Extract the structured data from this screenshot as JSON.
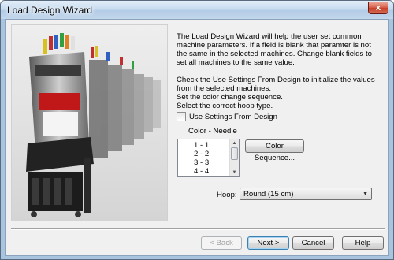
{
  "window": {
    "title": "Load Design Wizard",
    "close_label": "x"
  },
  "image": {
    "icon": "embroidery-machines-photo"
  },
  "intro": {
    "paragraph1": "The Load Design Wizard will help the user set common machine parameters. If a field is blank that paramter is not the same in the selected machines. Change blank fields to set all machines to the same value.",
    "line1": "Check the Use Settings From Design to initialize the values from the selected machines.",
    "line2": "Set the color change sequence.",
    "line3": "Select the correct hoop type."
  },
  "use_settings": {
    "label": "Use Settings From Design",
    "checked": false
  },
  "color_needle": {
    "label": "Color - Needle",
    "items": [
      "1 -  1",
      "2 -  2",
      "3 -  3",
      "4 -  4"
    ],
    "button_label": "Color Sequence..."
  },
  "hoop": {
    "label": "Hoop:",
    "value": "Round (15 cm)"
  },
  "footer": {
    "back_label": "< Back",
    "next_label": "Next >",
    "cancel_label": "Cancel",
    "help_label": "Help"
  },
  "colors": {
    "accent": "#3c7fb1",
    "title_bar": "#c7dbef",
    "close_button": "#c33e25"
  }
}
